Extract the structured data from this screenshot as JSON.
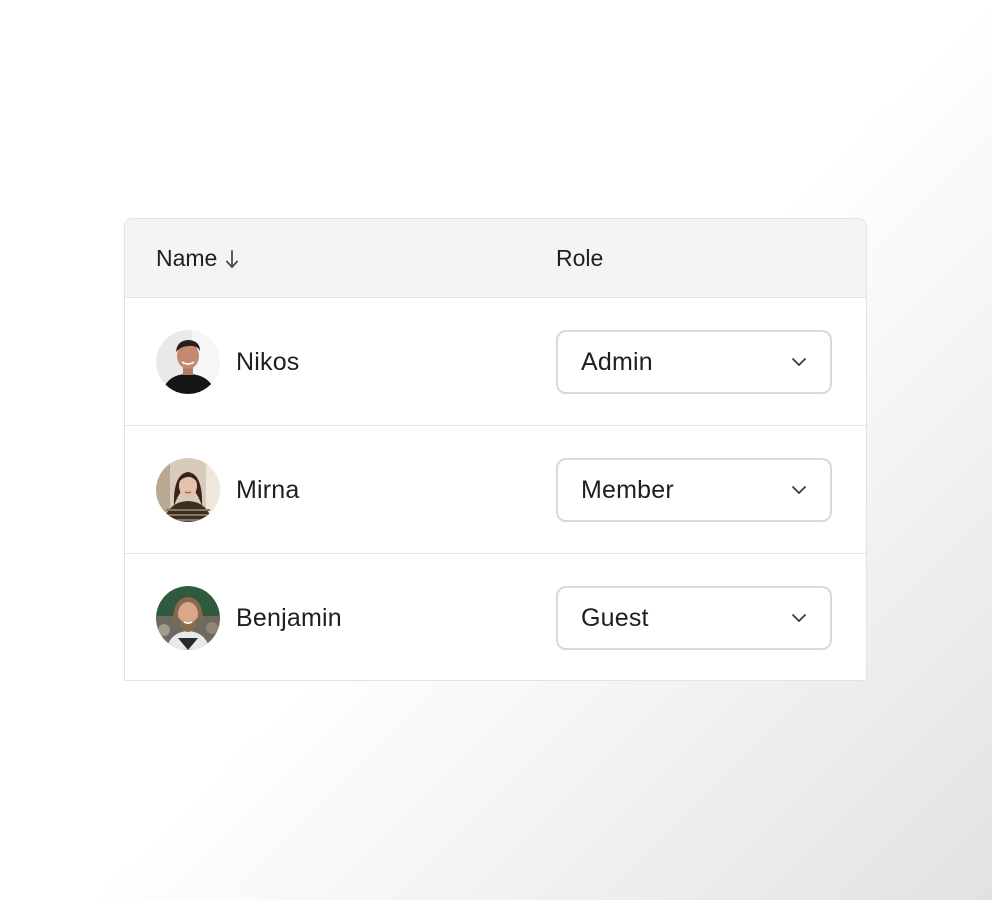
{
  "table": {
    "columns": {
      "name": {
        "label": "Name",
        "sort": "descending",
        "sort_icon": "arrow-down-icon"
      },
      "role": {
        "label": "Role"
      }
    },
    "rows": [
      {
        "name": "Nikos",
        "role": "Admin",
        "avatar_icon": "avatar-nikos"
      },
      {
        "name": "Mirna",
        "role": "Member",
        "avatar_icon": "avatar-mirna"
      },
      {
        "name": "Benjamin",
        "role": "Guest",
        "avatar_icon": "avatar-benjamin"
      }
    ]
  },
  "colors": {
    "header_background": "#f4f4f5",
    "border": "#dfe3ee",
    "select_border": "#d9d9dc",
    "text": "#1f1f23"
  }
}
